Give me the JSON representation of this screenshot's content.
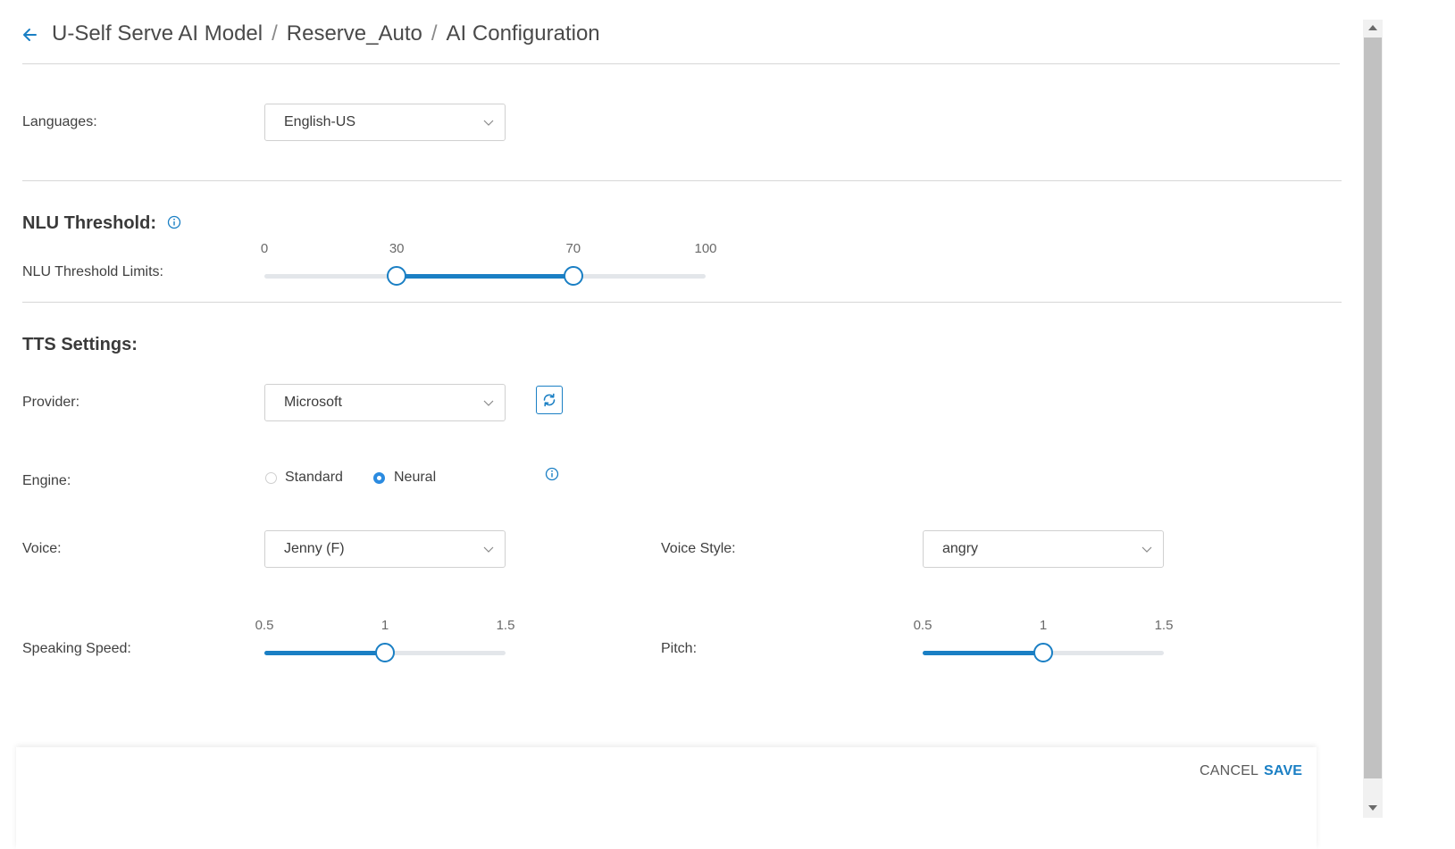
{
  "breadcrumb": {
    "items": [
      "U-Self Serve AI Model",
      "Reserve_Auto",
      "AI Configuration"
    ],
    "separator": "/"
  },
  "languages": {
    "label": "Languages:",
    "value": "English-US"
  },
  "nlu": {
    "title": "NLU Threshold:",
    "limits_label": "NLU Threshold Limits:",
    "min": 0,
    "max": 100,
    "low": 30,
    "high": 70,
    "tick_labels": [
      "0",
      "30",
      "70",
      "100"
    ]
  },
  "tts": {
    "title": "TTS Settings:",
    "provider_label": "Provider:",
    "provider_value": "Microsoft",
    "engine_label": "Engine:",
    "engine_options": [
      "Standard",
      "Neural"
    ],
    "engine_selected": "Neural",
    "voice_label": "Voice:",
    "voice_value": "Jenny (F)",
    "voice_style_label": "Voice Style:",
    "voice_style_value": "angry",
    "speed_label": "Speaking Speed:",
    "speed": {
      "min": 0.5,
      "max": 1.5,
      "value": 1,
      "tick_labels": [
        "0.5",
        "1",
        "1.5"
      ]
    },
    "pitch_label": "Pitch:",
    "pitch": {
      "min": 0.5,
      "max": 1.5,
      "value": 1,
      "tick_labels": [
        "0.5",
        "1",
        "1.5"
      ]
    }
  },
  "footer": {
    "cancel": "CANCEL",
    "save": "SAVE"
  },
  "colors": {
    "accent": "#1a7fc4",
    "radio_on": "#2b8be0",
    "divider": "#d7d7d7"
  }
}
